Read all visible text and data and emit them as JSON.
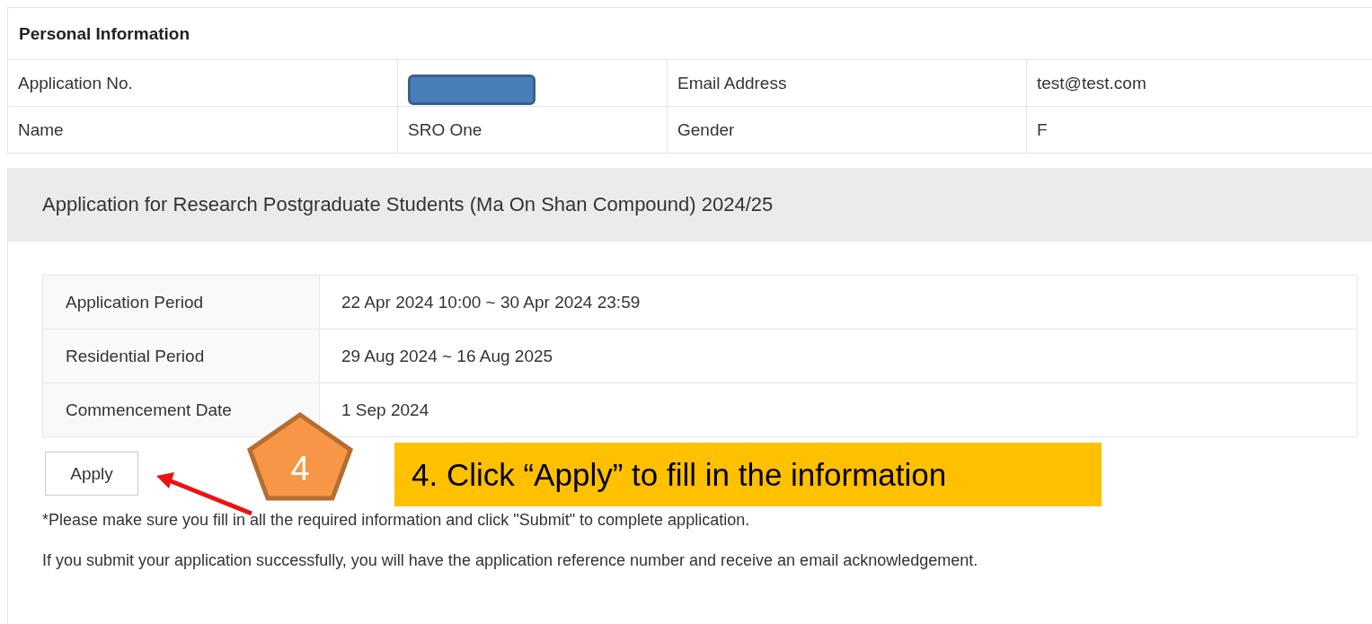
{
  "personal_information": {
    "title": "Personal Information",
    "rows": [
      {
        "cells": [
          {
            "kind": "text",
            "text": "Application No."
          },
          {
            "kind": "redacted"
          },
          {
            "kind": "text",
            "text": "Email Address"
          },
          {
            "kind": "text",
            "text": "test@test.com"
          }
        ]
      },
      {
        "cells": [
          {
            "kind": "text",
            "text": "Name"
          },
          {
            "kind": "text",
            "text": "SRO One"
          },
          {
            "kind": "text",
            "text": "Gender"
          },
          {
            "kind": "text",
            "text": "F"
          }
        ]
      }
    ]
  },
  "application": {
    "title": "Application for Research Postgraduate Students (Ma On Shan Compound) 2024/25",
    "details": [
      {
        "label": "Application Period",
        "value": "22 Apr 2024 10:00 ~ 30 Apr 2024 23:59"
      },
      {
        "label": "Residential Period",
        "value": "29 Aug 2024 ~ 16 Aug 2025"
      },
      {
        "label": "Commencement Date",
        "value": "1 Sep 2024"
      }
    ],
    "apply_button": "Apply",
    "note": "*Please make sure you fill in all the required information and click \"Submit\" to complete application.",
    "info": "If you submit your application successfully, you will have the application reference number and receive an email acknowledgement."
  },
  "annotation": {
    "step": "4",
    "callout": "4. Click “Apply” to fill in the information"
  }
}
